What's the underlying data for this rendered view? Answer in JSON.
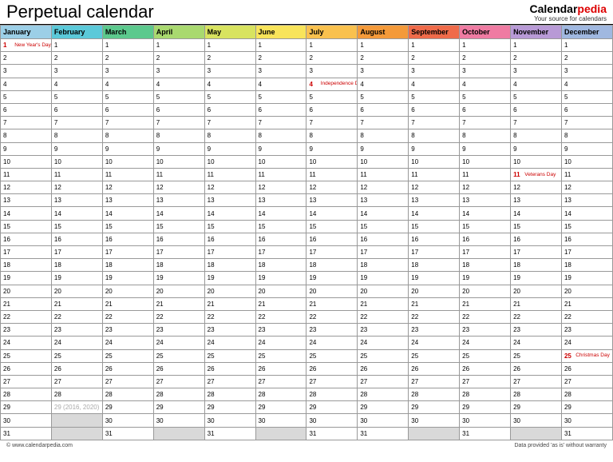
{
  "header": {
    "title": "Perpetual calendar"
  },
  "brand": {
    "name_a": "Calendar",
    "name_b": "pedia",
    "tagline": "Your source for calendars"
  },
  "months": [
    "January",
    "February",
    "March",
    "April",
    "May",
    "June",
    "July",
    "August",
    "September",
    "October",
    "November",
    "December"
  ],
  "month_days": [
    31,
    29,
    31,
    30,
    31,
    30,
    31,
    31,
    30,
    31,
    30,
    31
  ],
  "leap_note": "(2016, 2020)",
  "holidays": {
    "0-1": "New Year's Day",
    "6-4": "Independence Day",
    "10-11": "Veterans Day",
    "11-25": "Christmas Day"
  },
  "footer": {
    "left": "© www.calendarpedia.com",
    "right": "Data provided 'as is' without warranty"
  }
}
